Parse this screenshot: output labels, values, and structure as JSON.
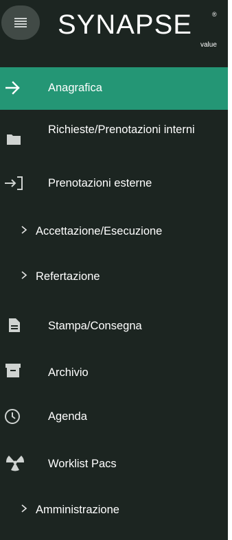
{
  "app": {
    "logo_text": "SYNAPSE",
    "logo_registered": "®",
    "logo_sub": "value",
    "colors": {
      "sidebar_bg": "#1c2521",
      "active_bg": "#249675",
      "hamburger_bg": "#414a46",
      "text": "#ffffff"
    }
  },
  "header": {
    "menu_icon": "hamburger-icon"
  },
  "menu": {
    "items": [
      {
        "label": "Anagrafica",
        "icon": "arrow-right-icon",
        "active": true
      },
      {
        "label": "Richieste/Prenotazioni interni",
        "icon": "folder-icon",
        "active": false
      },
      {
        "label": "Prenotazioni esterne",
        "icon": "login-icon",
        "active": false
      },
      {
        "label": "Accettazione/Esecuzione",
        "icon": "chevron-right-icon",
        "active": false,
        "expandable": true
      },
      {
        "label": "Refertazione",
        "icon": "chevron-right-icon",
        "active": false,
        "expandable": true
      },
      {
        "label": "Stampa/Consegna",
        "icon": "document-icon",
        "active": false
      },
      {
        "label": "Archivio",
        "icon": "archive-icon",
        "active": false
      },
      {
        "label": "Agenda",
        "icon": "clock-icon",
        "active": false
      },
      {
        "label": "Worklist Pacs",
        "icon": "radiation-icon",
        "active": false
      },
      {
        "label": "Amministrazione",
        "icon": "chevron-right-icon",
        "active": false,
        "expandable": true
      }
    ]
  }
}
